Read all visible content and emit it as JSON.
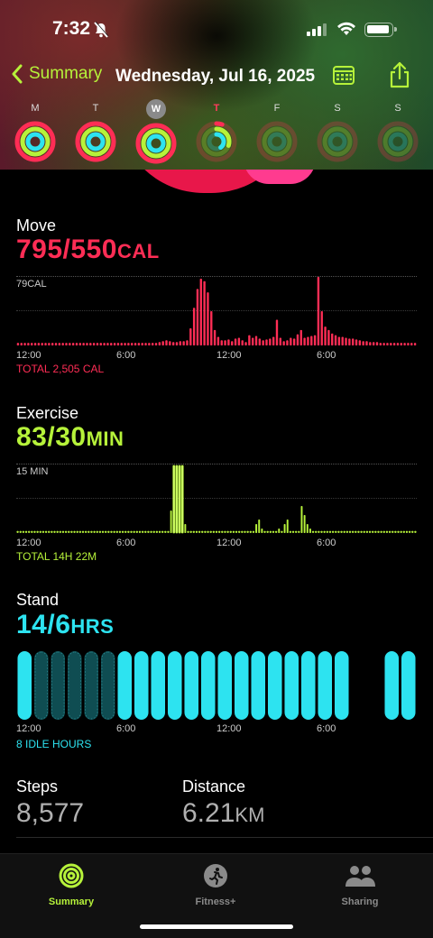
{
  "status": {
    "time": "7:32"
  },
  "nav": {
    "back_label": "Summary",
    "title": "Wednesday, Jul 16, 2025"
  },
  "week": [
    {
      "label": "M",
      "move": 1.0,
      "exercise": 1.0,
      "stand": 1.0,
      "state": "normal"
    },
    {
      "label": "T",
      "move": 1.0,
      "exercise": 1.0,
      "stand": 1.0,
      "state": "normal"
    },
    {
      "label": "W",
      "move": 1.0,
      "exercise": 1.0,
      "stand": 1.0,
      "state": "selected"
    },
    {
      "label": "T",
      "move": 0.05,
      "exercise": 0.3,
      "stand": 0.4,
      "state": "today"
    },
    {
      "label": "F",
      "move": 0,
      "exercise": 0,
      "stand": 0,
      "state": "future"
    },
    {
      "label": "S",
      "move": 0,
      "exercise": 0,
      "stand": 0,
      "state": "future"
    },
    {
      "label": "S",
      "move": 0,
      "exercise": 0,
      "stand": 0,
      "state": "future"
    }
  ],
  "colors": {
    "move": "#ff2d55",
    "exercise": "#b6f23a",
    "stand": "#2de3f0",
    "tab_active": "#b6f23a"
  },
  "move": {
    "title": "Move",
    "value": "795/550",
    "unit": "CAL",
    "max_label": "79CAL",
    "total": "TOTAL 2,505 CAL",
    "x_ticks": [
      "12:00",
      "6:00",
      "12:00",
      "6:00"
    ]
  },
  "exercise": {
    "title": "Exercise",
    "value": "83/30",
    "unit": "MIN",
    "max_label": "15 MIN",
    "total": "TOTAL 14H 22M",
    "x_ticks": [
      "12:00",
      "6:00",
      "12:00",
      "6:00"
    ]
  },
  "stand": {
    "title": "Stand",
    "value": "14/6",
    "unit": "HRS",
    "idle": "8 IDLE HOURS",
    "x_ticks": [
      "12:00",
      "6:00",
      "12:00",
      "6:00"
    ]
  },
  "steps": {
    "title": "Steps",
    "value": "8,577"
  },
  "distance": {
    "title": "Distance",
    "value": "6.21",
    "unit": "KM"
  },
  "tabs": [
    {
      "label": "Summary",
      "icon": "rings-icon",
      "active": true
    },
    {
      "label": "Fitness+",
      "icon": "runner-icon",
      "active": false
    },
    {
      "label": "Sharing",
      "icon": "people-icon",
      "active": false
    }
  ],
  "chart_data": [
    {
      "type": "bar",
      "title": "Move",
      "ylabel": "CAL",
      "ylim": [
        0,
        79
      ],
      "x_ticks": [
        "12:00",
        "6:00",
        "12:00",
        "6:00"
      ],
      "values": [
        3,
        3,
        3,
        3,
        3,
        3,
        3,
        3,
        3,
        3,
        3,
        3,
        3,
        3,
        3,
        3,
        3,
        3,
        3,
        3,
        3,
        3,
        3,
        3,
        3,
        3,
        3,
        3,
        3,
        3,
        3,
        3,
        3,
        3,
        3,
        3,
        3,
        3,
        3,
        3,
        3,
        4,
        5,
        6,
        5,
        4,
        4,
        5,
        5,
        6,
        20,
        44,
        66,
        78,
        75,
        62,
        40,
        18,
        10,
        6,
        6,
        7,
        5,
        8,
        9,
        6,
        4,
        12,
        9,
        11,
        8,
        6,
        7,
        8,
        10,
        30,
        9,
        5,
        6,
        9,
        8,
        13,
        18,
        9,
        10,
        11,
        12,
        80,
        40,
        22,
        18,
        14,
        12,
        10,
        10,
        9,
        8,
        8,
        7,
        6,
        5,
        5,
        4,
        4,
        4,
        3,
        3,
        3,
        3,
        3,
        3,
        3,
        3,
        3,
        3,
        3
      ]
    },
    {
      "type": "bar",
      "title": "Exercise",
      "ylabel": "MIN",
      "ylim": [
        0,
        15
      ],
      "x_ticks": [
        "12:00",
        "6:00",
        "12:00",
        "6:00"
      ],
      "values": [
        0,
        0,
        0,
        0,
        0,
        0,
        0,
        0,
        0,
        0,
        0,
        0,
        0,
        0,
        0,
        0,
        0,
        0,
        0,
        0,
        0,
        0,
        0,
        0,
        0,
        0,
        0,
        0,
        0,
        0,
        0,
        0,
        0,
        0,
        0,
        0,
        0,
        0,
        0,
        0,
        0,
        0,
        0,
        0,
        0,
        0,
        0,
        0,
        0,
        0,
        0,
        0,
        0,
        0,
        5,
        15,
        15,
        15,
        15,
        2,
        0,
        0,
        0,
        0,
        0,
        0,
        0,
        0,
        0,
        0,
        0,
        0,
        0,
        0,
        0,
        0,
        0,
        0,
        0,
        0,
        0,
        0,
        0,
        0,
        2,
        3,
        1,
        0,
        0,
        0,
        0,
        0,
        1,
        0,
        2,
        3,
        0,
        0,
        0,
        0,
        6,
        4,
        2,
        1,
        0,
        0,
        0,
        0,
        0,
        0,
        0,
        0,
        0,
        0,
        0,
        0,
        0,
        0,
        0,
        0,
        0,
        0,
        0,
        0,
        0,
        0,
        0,
        0,
        0,
        0,
        0,
        0,
        0,
        0,
        0,
        0,
        0,
        0,
        0,
        0,
        0
      ]
    },
    {
      "type": "bar",
      "title": "Stand",
      "ylabel": "HRS",
      "x_ticks": [
        "12:00",
        "6:00",
        "12:00",
        "6:00"
      ],
      "values": [
        1,
        0,
        0,
        0,
        0,
        0,
        1,
        1,
        1,
        1,
        1,
        1,
        1,
        1,
        1,
        1,
        1,
        1,
        1,
        1,
        0,
        0,
        1,
        1,
        1,
        1
      ],
      "note": "1 = stood in hour, 0 = idle; last two empty slots are future hours"
    }
  ]
}
